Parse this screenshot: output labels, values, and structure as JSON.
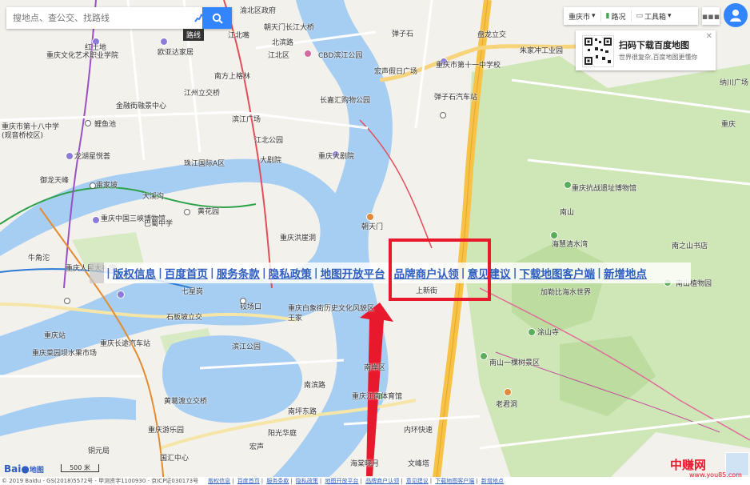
{
  "search": {
    "placeholder": "搜地点、查公交、找路线",
    "route_tooltip": "路线"
  },
  "toolbar": {
    "city": "重庆市",
    "traffic": "路况",
    "tools": "工具箱"
  },
  "qr_panel": {
    "title": "扫码下载百度地图",
    "subtitle": "世界很复杂,百度地图更懂你"
  },
  "link_bar": {
    "items": [
      "版权信息",
      "百度首页",
      "服务条款",
      "隐私政策",
      "地图开放平台",
      "品牌商户认领",
      "意见建议",
      "下载地图客户端",
      "新增地点"
    ]
  },
  "bottom": {
    "copyright": "© 2019 Baidu - GS(2018)5572号 - 甲测资字1100930 - 京ICP证030173号",
    "links": [
      "版权信息",
      "百度首页",
      "服务条款",
      "隐私政策",
      "地图开放平台",
      "品牌商户认领",
      "意见建议",
      "下载地图客户端",
      "新增地点"
    ]
  },
  "logo": {
    "brand": "Bai",
    "brand2": "地图"
  },
  "scale": "500 米",
  "watermark": {
    "text": "中赚网",
    "url": "www.you85.com"
  },
  "map_labels": [
    {
      "t": "红土地"
    },
    {
      "t": "重庆文化艺术职业学院"
    },
    {
      "t": "欧亚达家居"
    },
    {
      "t": "渝北区政府"
    },
    {
      "t": "朝天门长江大桥"
    },
    {
      "t": "弹子石"
    },
    {
      "t": "盘龙立交"
    },
    {
      "t": "北滨路"
    },
    {
      "t": "江北嘴"
    },
    {
      "t": "CBD滨江公园"
    },
    {
      "t": "南方上格林"
    },
    {
      "t": "金融街融景中心"
    },
    {
      "t": "江州立交桥"
    },
    {
      "t": "宏声假日广场"
    },
    {
      "t": "重庆市第十一中学校"
    },
    {
      "t": "弹子石汽车站"
    },
    {
      "t": "长嘉汇购物公园"
    },
    {
      "t": "重庆市第十八中学"
    },
    {
      "t": "(观音桥校区)"
    },
    {
      "t": "鲤鱼池"
    },
    {
      "t": "江北公园"
    },
    {
      "t": "龙湖星悦荟"
    },
    {
      "t": "大剧院"
    },
    {
      "t": "重庆大剧院"
    },
    {
      "t": "珠江国际A区"
    },
    {
      "t": "御龙天峰"
    },
    {
      "t": "雷家坡"
    },
    {
      "t": "大溪沟"
    },
    {
      "t": "黄花园"
    },
    {
      "t": "重庆中国三峡博物馆"
    },
    {
      "t": "巴蜀中学"
    },
    {
      "t": "朝天门"
    },
    {
      "t": "重庆洪崖洞"
    },
    {
      "t": "牛角沱"
    },
    {
      "t": "七星岗"
    },
    {
      "t": "重庆人民大礼堂"
    },
    {
      "t": "较场口"
    },
    {
      "t": "重庆白象街历史文化风貌区"
    },
    {
      "t": "石板坡立交"
    },
    {
      "t": "滨江公园"
    },
    {
      "t": "重庆长途汽车站"
    },
    {
      "t": "重庆站"
    },
    {
      "t": "重庆菜园坝水果市场"
    },
    {
      "t": "南滨路"
    },
    {
      "t": "南山"
    },
    {
      "t": "黄葛渡立交桥"
    },
    {
      "t": "重庆游乐园"
    },
    {
      "t": "阳光华庭"
    },
    {
      "t": "重庆江南体育馆"
    },
    {
      "t": "海棠晓月"
    },
    {
      "t": "铜元局"
    },
    {
      "t": "国汇中心"
    },
    {
      "t": "宏声"
    },
    {
      "t": "南坪东路"
    },
    {
      "t": "重庆抗战遗址博物馆"
    },
    {
      "t": "海慧清水湾"
    },
    {
      "t": "南之山书店"
    },
    {
      "t": "加勒比海水世界"
    },
    {
      "t": "南山植物园"
    },
    {
      "t": "涂山寺"
    },
    {
      "t": "南山一棵树景区"
    },
    {
      "t": "老君洞"
    },
    {
      "t": "文峰塔"
    },
    {
      "t": "上新街"
    },
    {
      "t": "朱家冲工业园"
    },
    {
      "t": "纳川广场"
    },
    {
      "t": "南岸区"
    },
    {
      "t": "王家"
    },
    {
      "t": "滨江广场"
    },
    {
      "t": "内环快速"
    },
    {
      "t": "江北区"
    },
    {
      "t": "重庆"
    }
  ]
}
